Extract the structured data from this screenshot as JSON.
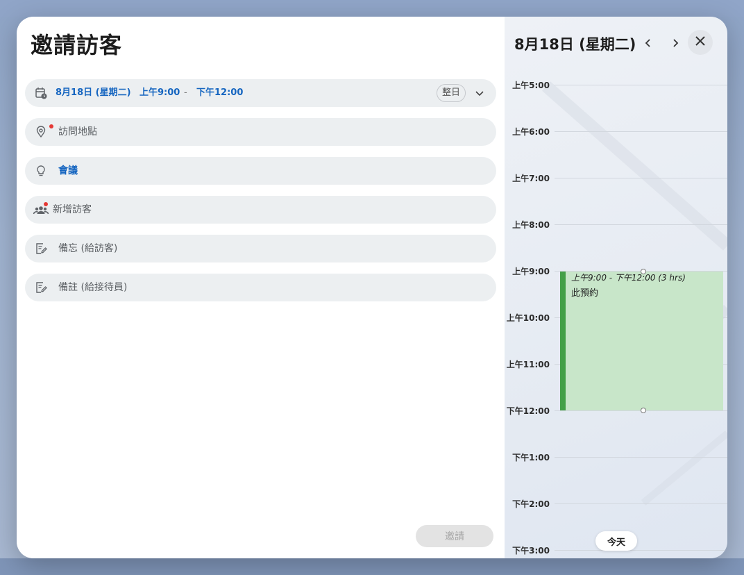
{
  "form": {
    "title": "邀請訪客",
    "datetime": {
      "date": "8月18日 (星期二)",
      "start": "上午9:00",
      "separator": "-",
      "end": "下午12:00",
      "allday_label": "整日"
    },
    "location_placeholder": "訪問地點",
    "purpose_value": "會議",
    "add_guest_placeholder": "新增訪客",
    "memo_guest_placeholder": "備忘 (給訪客)",
    "memo_staff_placeholder": "備註 (給接待員)",
    "invite_label": "邀請"
  },
  "calendar": {
    "header_date": "8月18日 (星期二)",
    "hours": [
      "上午5:00",
      "上午6:00",
      "上午7:00",
      "上午8:00",
      "上午9:00",
      "上午10:00",
      "上午11:00",
      "下午12:00",
      "下午1:00",
      "下午2:00",
      "下午3:00"
    ],
    "event": {
      "time_range": "上午9:00 - 下午12:00 (3 hrs)",
      "title": "此預約"
    },
    "today_label": "今天"
  },
  "colors": {
    "accent_blue": "#1565c0",
    "event_fill": "#c8e6c9",
    "event_bar": "#43a047",
    "required_dot": "#e53935"
  },
  "icons": [
    "calendar-clock-icon",
    "location-pin-icon",
    "lightbulb-icon",
    "people-icon",
    "note-edit-icon",
    "chevron-down-icon",
    "chevron-left-icon",
    "chevron-right-icon",
    "close-icon"
  ]
}
